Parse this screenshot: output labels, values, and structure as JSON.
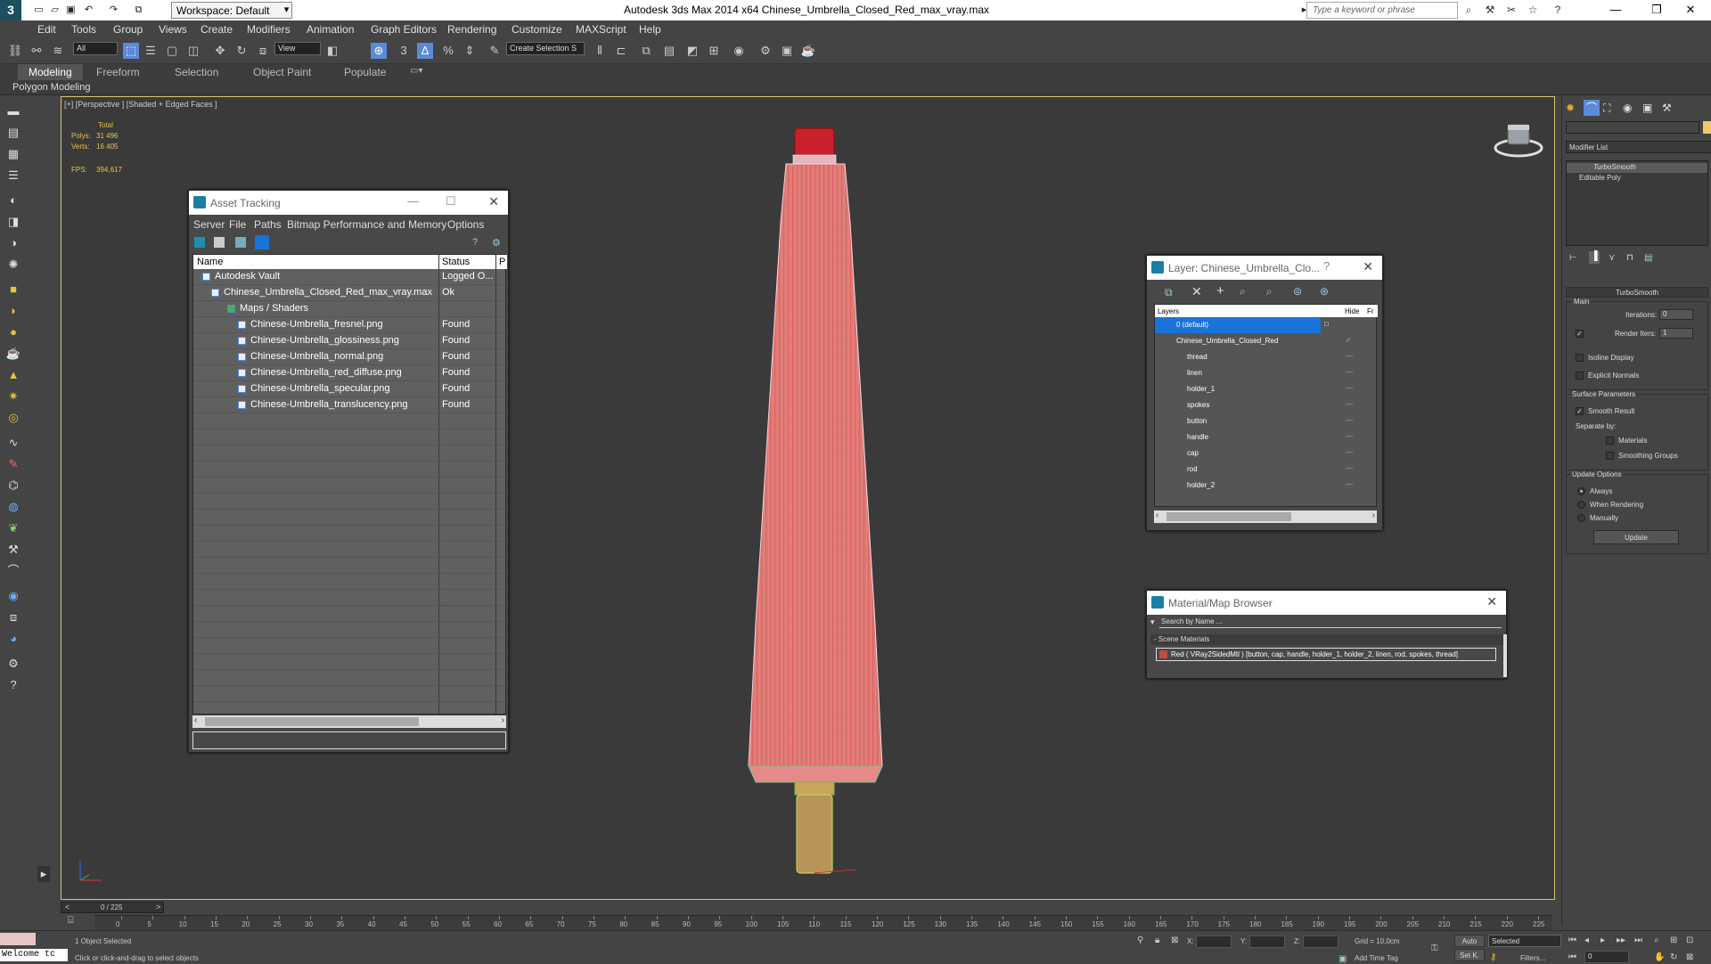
{
  "app": {
    "title": "Autodesk 3ds Max  2014 x64     Chinese_Umbrella_Closed_Red_max_vray.max",
    "logo": "3",
    "workspace": "Workspace: Default",
    "search_placeholder": "Type a keyword or phrase",
    "window_buttons": [
      "—",
      "❐",
      "✕"
    ]
  },
  "menu": [
    "Edit",
    "Tools",
    "Group",
    "Views",
    "Create",
    "Modifiers",
    "Animation",
    "Graph Editors",
    "Rendering",
    "Customize",
    "MAXScript",
    "Help"
  ],
  "toolbar": {
    "selection_filter": "All",
    "ref_coord": "View",
    "named_selection": "Create Selection S"
  },
  "ribbon": {
    "tabs": [
      "Modeling",
      "Freeform",
      "Selection",
      "Object Paint",
      "Populate"
    ],
    "active_tab": "Modeling",
    "panel_label": "Polygon Modeling"
  },
  "viewport": {
    "label": "[+] [Perspective ] [Shaded + Edged Faces ]",
    "stats": {
      "total_label": "Total",
      "polys_label": "Polys:",
      "polys_value": "31 496",
      "verts_label": "Verts:",
      "verts_value": "16 405",
      "fps_label": "FPS:",
      "fps_value": "394,617"
    }
  },
  "asset_tracking": {
    "title": "Asset Tracking",
    "menu": [
      "Server",
      "File",
      "Paths",
      "Bitmap Performance and Memory",
      "Options"
    ],
    "columns": [
      "Name",
      "Status",
      "P"
    ],
    "rows": [
      {
        "name": "Autodesk Vault",
        "status": "Logged O..."
      },
      {
        "name": "Chinese_Umbrella_Closed_Red_max_vray.max",
        "status": "Ok"
      },
      {
        "name": "Maps / Shaders",
        "status": ""
      },
      {
        "name": "Chinese-Umbrella_fresnel.png",
        "status": "Found"
      },
      {
        "name": "Chinese-Umbrella_glossiness.png",
        "status": "Found"
      },
      {
        "name": "Chinese-Umbrella_normal.png",
        "status": "Found"
      },
      {
        "name": "Chinese-Umbrella_red_diffuse.png",
        "status": "Found"
      },
      {
        "name": "Chinese-Umbrella_specular.png",
        "status": "Found"
      },
      {
        "name": "Chinese-Umbrella_translucency.png",
        "status": "Found"
      }
    ]
  },
  "layer_dialog": {
    "title": "Layer: Chinese_Umbrella_Clo...",
    "help": "?",
    "columns": [
      "Layers",
      "Hide",
      "Fr"
    ],
    "rows": [
      {
        "name": "0 (default)"
      },
      {
        "name": "Chinese_Umbrella_Closed_Red"
      },
      {
        "name": "thread"
      },
      {
        "name": "linen"
      },
      {
        "name": "holder_1"
      },
      {
        "name": "spokes"
      },
      {
        "name": "button"
      },
      {
        "name": "handle"
      },
      {
        "name": "cap"
      },
      {
        "name": "rod"
      },
      {
        "name": "holder_2"
      }
    ]
  },
  "material_browser": {
    "title": "Material/Map Browser",
    "search_placeholder": "Search by Name ...",
    "section": "- Scene Materials",
    "item": "Red  ( VRay2SidedMtl ) [button, cap, handle, holder_1, holder_2, linen, rod, spokes, thread]"
  },
  "command_panel": {
    "modifier_list_label": "Modifier List",
    "stack": [
      "TurboSmooth",
      "Editable Poly"
    ],
    "rollout_title": "TurboSmooth",
    "main_label": "Main",
    "iterations_label": "Iterations:",
    "iterations_value": "0",
    "render_iters_label": "Render Iters:",
    "render_iters_value": "1",
    "isoline_label": "Isoline Display",
    "explicit_normals_label": "Explicit Normals",
    "surface_label": "Surface Parameters",
    "smooth_result_label": "Smooth Result",
    "separate_by_label": "Separate by:",
    "materials_label": "Materials",
    "smoothing_groups_label": "Smoothing Groups",
    "update_options_label": "Update Options",
    "always_label": "Always",
    "when_rendering_label": "When Rendering",
    "manually_label": "Manually",
    "update_button": "Update"
  },
  "timeline": {
    "frame_counter": "0 / 225",
    "ticks": [
      "0",
      "5",
      "10",
      "15",
      "20",
      "25",
      "30",
      "35",
      "40",
      "45",
      "50",
      "55",
      "60",
      "65",
      "70",
      "75",
      "80",
      "85",
      "90",
      "95",
      "100",
      "105",
      "110",
      "115",
      "120",
      "125",
      "130",
      "135",
      "140",
      "145",
      "150",
      "155",
      "160",
      "165",
      "170",
      "175",
      "180",
      "185",
      "190",
      "195",
      "200",
      "205",
      "210",
      "215",
      "220",
      "225"
    ]
  },
  "status": {
    "welcome": "Welcome tc",
    "selected": "1 Object Selected",
    "hint": "Click or click-and-drag to select objects",
    "x_label": "X:",
    "y_label": "Y:",
    "z_label": "Z:",
    "grid": "Grid = 10,0cm",
    "add_time_tag": "Add Time Tag",
    "auto": "Auto",
    "set_key": "Set K.",
    "selected_dropdown": "Selected",
    "filters": "Filters...",
    "frame": "0"
  },
  "colors": {
    "viewport_border": "#d7c36a",
    "umbrella_red": "#e8706b",
    "accent_blue": "#1a73d9",
    "stats_yellow": "#e6c447"
  }
}
